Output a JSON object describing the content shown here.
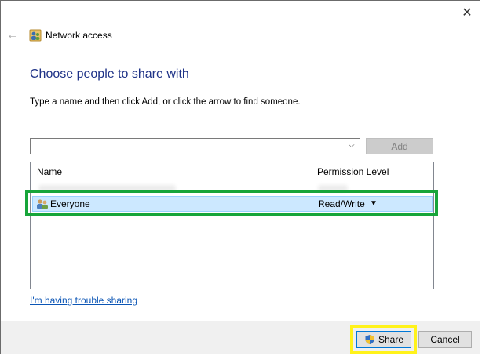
{
  "window": {
    "title": "Network access",
    "close_glyph": "✕",
    "back_glyph": "←"
  },
  "main": {
    "heading": "Choose people to share with",
    "instruction": "Type a name and then click Add, or click the arrow to find someone.",
    "name_input": {
      "value": "",
      "placeholder": ""
    },
    "combo_arrow": "⌵",
    "add_label": "Add"
  },
  "list": {
    "columns": [
      "Name",
      "Permission Level"
    ],
    "rows": [
      {
        "name": "Everyone",
        "permission": "Read/Write",
        "selected": true
      }
    ],
    "perm_arrow": "▼"
  },
  "trouble_link": "I'm having trouble sharing",
  "footer": {
    "share_label": "Share",
    "cancel_label": "Cancel"
  },
  "colors": {
    "heading": "#1e3287",
    "link": "#0b55b5",
    "selection": "#cce8ff",
    "highlight_green": "#17a53a",
    "highlight_yellow": "#fff21a"
  },
  "icons": {
    "title": "network-users-icon",
    "row": "users-group-icon",
    "share": "uac-shield-icon"
  }
}
